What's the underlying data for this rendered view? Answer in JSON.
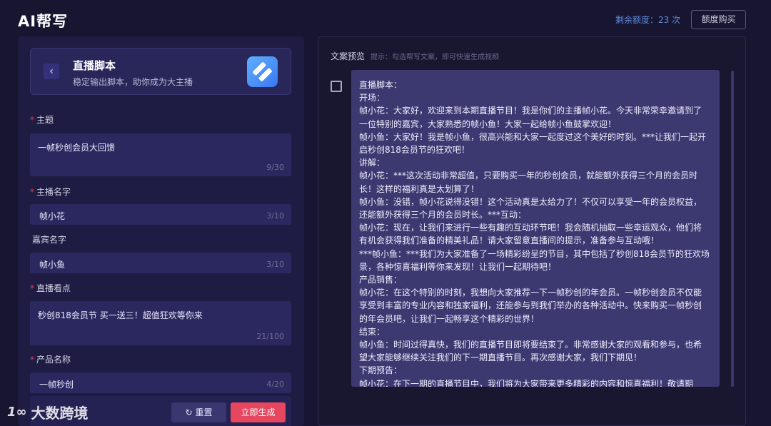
{
  "app": {
    "title": "AI帮写"
  },
  "header": {
    "quota": "剩余额度：23 次",
    "buy_label": "额度购买"
  },
  "card": {
    "title": "直播脚本",
    "subtitle": "稳定输出脚本，助你成为大主播",
    "back_glyph": "‹"
  },
  "fields": [
    {
      "label": "主题",
      "required": "*",
      "value": "一帧秒创会员大回馈",
      "count": "9/30"
    },
    {
      "label": "主播名字",
      "required": "*",
      "value": "帧小花",
      "count": "3/10"
    },
    {
      "label": "嘉宾名字",
      "required": "",
      "value": "帧小鱼",
      "count": "3/10"
    },
    {
      "label": "直播看点",
      "required": "*",
      "value": "秒创818会员节 买一送三！超值狂欢等你来",
      "count": "21/100"
    },
    {
      "label": "产品名称",
      "required": "*",
      "value": "一帧秒创",
      "count": "4/20"
    }
  ],
  "actions": {
    "reset_label": "重置",
    "reset_icon": "↻",
    "generate_label": "立即生成"
  },
  "watermark": {
    "text": "大数跨境"
  },
  "preview": {
    "label": "文案预览",
    "hint": "提示：勾选帮写文案，即可快速生成视频",
    "script": "直播脚本：\n开场：\n帧小花：大家好，欢迎来到本期直播节目！我是你们的主播帧小花。今天非常荣幸邀请到了一位特别的嘉宾，大家熟悉的帧小鱼！大家一起给帧小鱼鼓掌欢迎！\n帧小鱼：大家好！我是帧小鱼，很高兴能和大家一起度过这个美好的时刻。***让我们一起开启秒创818会员节的狂欢吧！\n讲解：\n帧小花：***这次活动非常超值，只要购买一年的秒创会员，就能额外获得三个月的会员时长！这样的福利真是太划算了！\n帧小鱼：没错，帧小花说得没错！这个活动真是太给力了！不仅可以享受一年的会员权益，还能额外获得三个月的会员时长。***互动：\n帧小花：现在，让我们来进行一些有趣的互动环节吧！我会随机抽取一些幸运观众，他们将有机会获得我们准备的精美礼品！请大家留意直播间的提示，准备参与互动哦！\n***帧小鱼：***我们为大家准备了一场精彩纷呈的节目，其中包括了秒创818会员节的狂欢场景，各种惊喜福利等你来发现！让我们一起期待吧！\n产品销售：\n帧小花：在这个特别的时刻，我想向大家推荐一下一帧秒创的年会员。一帧秒创会员不仅能享受到丰富的专业内容和独家福利，还能参与到我们举办的各种活动中。快来购买一帧秒创的年会员吧，让我们一起畅享这个精彩的世界！\n结束：\n帧小鱼：时间过得真快，我们的直播节目即将要结束了。非常感谢大家的观看和参与，也希望大家能够继续关注我们的下一期直播节目。再次感谢大家，我们下期见！\n下期预告：\n帧小花：在下一期的直播节目中，我们将为大家带来更多精彩的内容和惊喜福利！敬请期待！"
  },
  "colors": {
    "accent": "#e6465e",
    "quota": "#5d8de0",
    "panel": "#1f1c43",
    "script_bg": "#3c3870"
  }
}
